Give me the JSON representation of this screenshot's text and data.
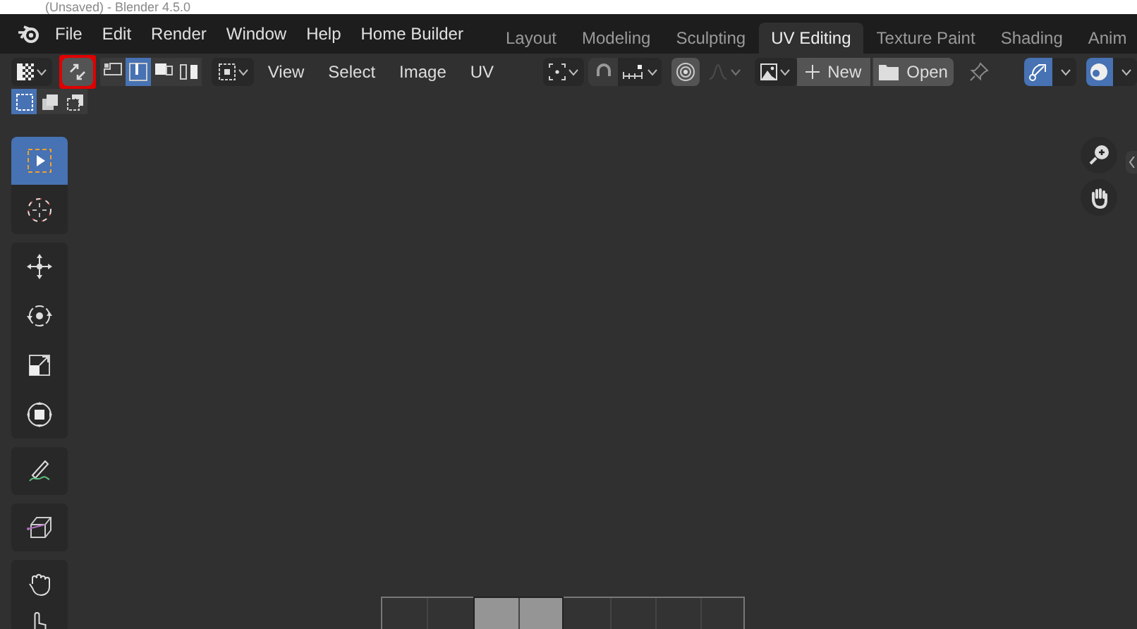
{
  "window": {
    "title": "(Unsaved) - Blender 4.5.0"
  },
  "menu": [
    "File",
    "Edit",
    "Render",
    "Window",
    "Help",
    "Home Builder"
  ],
  "workspace_tabs": [
    {
      "label": "Layout",
      "selected": false
    },
    {
      "label": "Modeling",
      "selected": false
    },
    {
      "label": "Sculpting",
      "selected": false
    },
    {
      "label": "UV Editing",
      "selected": true
    },
    {
      "label": "Texture Paint",
      "selected": false
    },
    {
      "label": "Shading",
      "selected": false
    },
    {
      "label": "Anim",
      "selected": false
    }
  ],
  "header": {
    "sync_toggle": {
      "highlighted": true
    },
    "select_modes": [
      {
        "kind": "vertex",
        "selected": false
      },
      {
        "kind": "edge",
        "selected": true
      },
      {
        "kind": "face",
        "selected": false
      },
      {
        "kind": "island",
        "selected": false
      }
    ],
    "menus": [
      "View",
      "Select",
      "Image",
      "UV"
    ],
    "snap": {
      "on": false
    },
    "proportional_edit": {
      "on": false
    },
    "new_button": "New",
    "open_button": "Open",
    "uv_sticky": {
      "on": true
    },
    "overlays": {
      "on": true
    }
  },
  "box_modes": [
    {
      "kind": "set",
      "selected": true
    },
    {
      "kind": "extend",
      "selected": false
    },
    {
      "kind": "subtract",
      "selected": false
    }
  ],
  "tools": [
    {
      "kind": "select",
      "selected": true
    },
    {
      "kind": "cursor",
      "selected": false
    },
    {
      "kind": "move",
      "selected": false
    },
    {
      "kind": "rotate",
      "selected": false
    },
    {
      "kind": "scale",
      "selected": false
    },
    {
      "kind": "transform",
      "selected": false
    },
    {
      "kind": "annotate",
      "selected": false
    },
    {
      "kind": "rip",
      "selected": false
    },
    {
      "kind": "grab",
      "selected": false
    },
    {
      "kind": "pinch",
      "selected": false
    }
  ]
}
